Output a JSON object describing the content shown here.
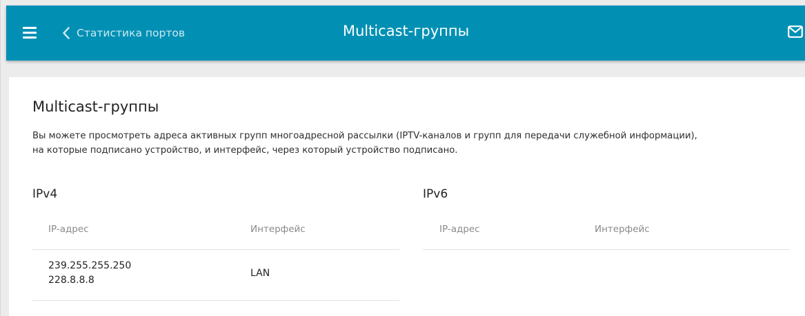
{
  "header": {
    "back_label": "Статистика портов",
    "title": "Multicast-группы",
    "menu_icon": "hamburger-menu-icon",
    "back_icon": "chevron-left-icon",
    "mail_icon": "envelope-icon",
    "bar_color": "#0190b4"
  },
  "content": {
    "title": "Multicast-группы",
    "description_line1": "Вы можете просмотреть адреса активных групп многоадресной рассылки (IPTV-каналов и групп для передачи служебной информации),",
    "description_line2": "на которые подписано устройство, и интерфейс, через который устройство подписано."
  },
  "ipv4": {
    "title": "IPv4",
    "columns": [
      "IP-адрес",
      "Интерфейс"
    ],
    "rows": [
      {
        "addresses": [
          "239.255.255.250",
          "228.8.8.8"
        ],
        "interface": "LAN"
      }
    ]
  },
  "ipv6": {
    "title": "IPv6",
    "columns": [
      "IP-адрес",
      "Интерфейс"
    ],
    "rows": []
  }
}
